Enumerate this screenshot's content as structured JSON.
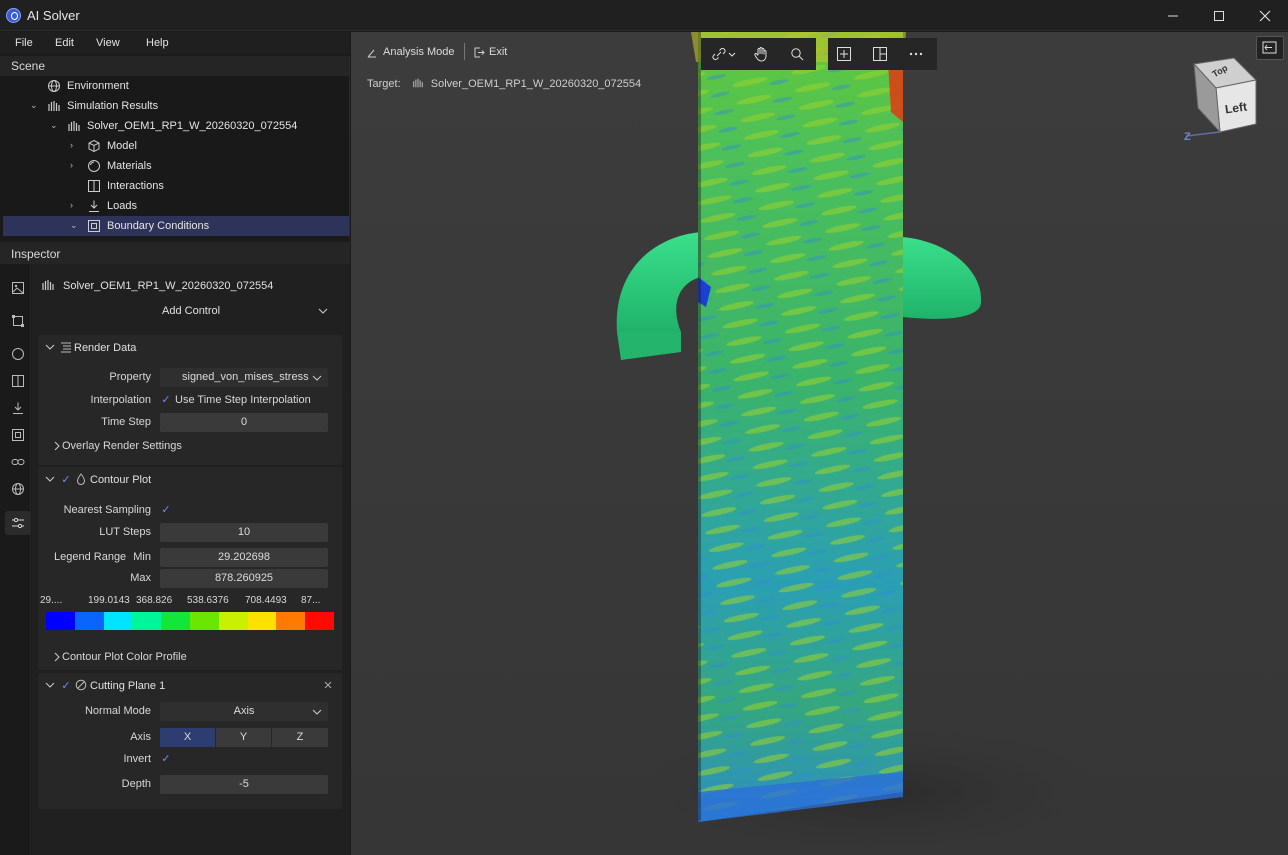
{
  "window": {
    "title": "AI Solver",
    "controls": [
      "minimize-icon",
      "maximize-icon",
      "close-icon"
    ]
  },
  "menu": {
    "items": [
      "File",
      "Edit",
      "View",
      "Help"
    ]
  },
  "scene": {
    "header": "Scene",
    "tree": [
      {
        "label": "Environment",
        "icon": "globe-icon"
      },
      {
        "label": "Simulation Results",
        "icon": "bars-icon"
      },
      {
        "label": "Solver_OEM1_RP1_W_20260320_072554",
        "icon": "bars-icon"
      },
      {
        "label": "Model",
        "icon": "cube-icon"
      },
      {
        "label": "Materials",
        "icon": "sphere-icon"
      },
      {
        "label": "Interactions",
        "icon": "split-icon"
      },
      {
        "label": "Loads",
        "icon": "download-arrow-icon"
      },
      {
        "label": "Boundary Conditions",
        "icon": "frame-icon"
      }
    ]
  },
  "inspector": {
    "header": "Inspector",
    "target_name": "Solver_OEM1_RP1_W_20260320_072554",
    "add_control": "Add Control",
    "render_data": {
      "title": "Render Data",
      "property_label": "Property",
      "property_value": "signed_von_mises_stress",
      "interpolation_label": "Interpolation",
      "interpolation_value": "Use Time Step Interpolation",
      "time_step_label": "Time Step",
      "time_step_value": "0",
      "overlay": "Overlay Render Settings"
    },
    "contour_plot": {
      "title": "Contour Plot",
      "nearest_label": "Nearest Sampling",
      "lut_label": "LUT Steps",
      "lut_value": "10",
      "legend_label": "Legend Range",
      "min_label": "Min",
      "min_value": "29.202698",
      "max_label": "Max",
      "max_value": "878.260925",
      "ticks": [
        "29....",
        "199.0143",
        "368.826",
        "538.6376",
        "708.4493",
        "87..."
      ],
      "colors": [
        "#0000ff",
        "#0a64ff",
        "#00e5ff",
        "#00f59a",
        "#12e63a",
        "#6ae600",
        "#c8f000",
        "#ffe100",
        "#ff7a00",
        "#ff0a00"
      ],
      "color_profile": "Contour Plot Color Profile"
    },
    "cutting_plane": {
      "title": "Cutting Plane 1",
      "normal_mode_label": "Normal Mode",
      "normal_mode_value": "Axis",
      "axis_label": "Axis",
      "axes": [
        "X",
        "Y",
        "Z"
      ],
      "invert_label": "Invert",
      "depth_label": "Depth",
      "depth_value": "-5"
    }
  },
  "viewport": {
    "analysis_mode": "Analysis Mode",
    "exit": "Exit",
    "target_label": "Target:",
    "target_value": "Solver_OEM1_RP1_W_20260320_072554",
    "view_cube_face": "Left",
    "view_cube_top": "Top",
    "axis_z": "Z"
  }
}
